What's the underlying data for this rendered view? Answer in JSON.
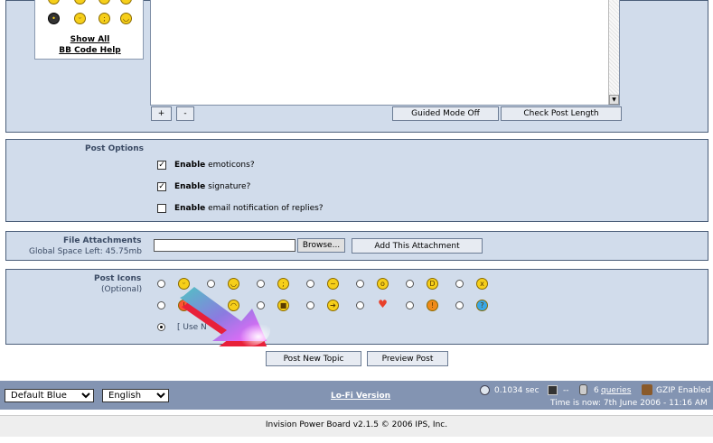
{
  "emoticons": {
    "show_all": "Show All",
    "bbcode_help": "BB Code Help"
  },
  "editor": {
    "plus_label": "+",
    "minus_label": "-",
    "guided_mode": "Guided Mode Off",
    "check_length": "Check Post Length"
  },
  "post_options": {
    "title": "Post Options",
    "options": [
      {
        "bold": "Enable",
        "text": "emoticons?",
        "checked": true
      },
      {
        "bold": "Enable",
        "text": "signature?",
        "checked": true
      },
      {
        "bold": "Enable",
        "text": "email notification of replies?",
        "checked": false
      }
    ]
  },
  "attachments": {
    "title": "File Attachments",
    "space_left": "Global Space Left: 45.75mb",
    "browse": "Browse...",
    "add": "Add This Attachment",
    "file_value": ""
  },
  "post_icons": {
    "title": "Post Icons",
    "optional": "(Optional)",
    "use_none": "[ Use N",
    "row1_icons": [
      "smile-icon",
      "grin-icon",
      "wink-icon",
      "thinking-icon",
      "shocked-icon",
      "laugh-icon",
      "angry-icon"
    ],
    "row2_icons": [
      "mad-icon",
      "sad-icon",
      "cool-icon",
      "arrow-icon",
      "heart-icon",
      "alert-icon",
      "question-icon"
    ]
  },
  "actions": {
    "post_new_topic": "Post New Topic",
    "preview_post": "Preview Post"
  },
  "footer": {
    "skin": "Default Blue",
    "language": "English",
    "lofi": "Lo-Fi Version",
    "time_exec": "0.1034 sec",
    "dashes": "--",
    "queries_count": "6",
    "queries_label": "queries",
    "gzip": "GZIP Enabled",
    "time_now": "Time is now: 7th June 2006 - 11:16 AM",
    "copyright": "Invision Power Board v2.1.5 © 2006  IPS, Inc."
  }
}
